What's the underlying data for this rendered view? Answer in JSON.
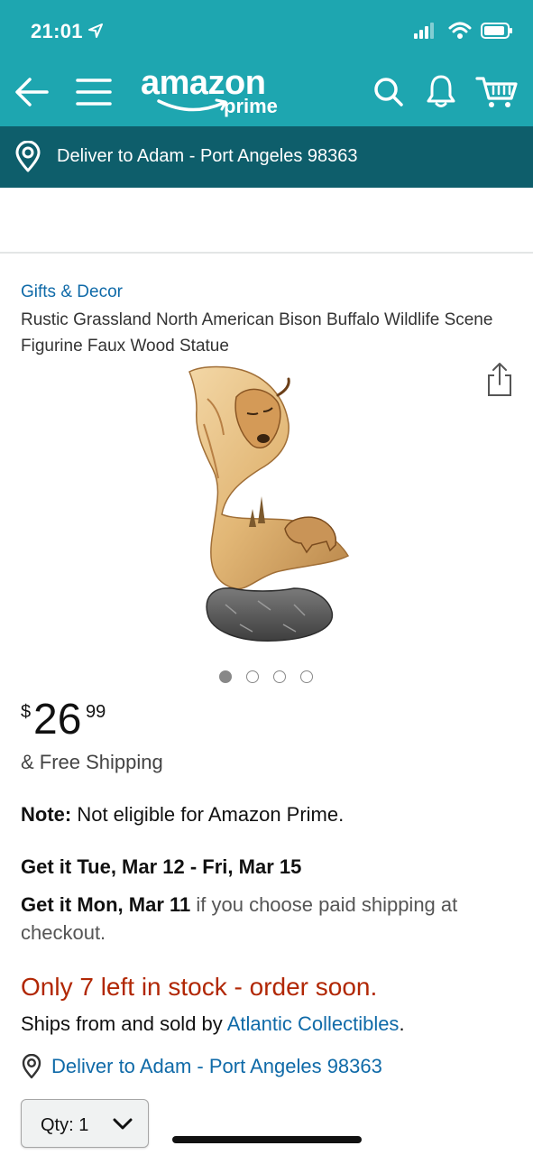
{
  "status_bar": {
    "time": "21:01",
    "icons": [
      "location-arrow-icon",
      "signal-icon",
      "wifi-icon",
      "battery-icon"
    ]
  },
  "header": {
    "logo_text": "amazon",
    "logo_subtext": "prime",
    "icons": [
      "back-arrow-icon",
      "menu-icon",
      "search-icon",
      "bell-icon",
      "cart-icon"
    ]
  },
  "delivery": {
    "text": "Deliver to Adam - Port Angeles 98363"
  },
  "product": {
    "byline": "Gifts & Decor",
    "title": "Rustic Grassland North American Bison Buffalo Wildlife Scene Figurine Faux Wood Statue",
    "image_count": 4,
    "active_image": 1,
    "price": {
      "currency": "$",
      "whole": "26",
      "fraction": "99"
    },
    "shipping": "& Free Shipping",
    "note_label": "Note:",
    "note_text": " Not eligible for Amazon Prime.",
    "delivery_primary": "Get it Tue, Mar 12 - Fri, Mar 15",
    "delivery_paid_bold": "Get it Mon, Mar 11",
    "delivery_paid_rest": " if you choose paid shipping at checkout.",
    "stock": "Only 7 left in stock - order soon.",
    "ships_prefix": "Ships from and sold by ",
    "seller": "Atlantic Collectibles",
    "ships_suffix": ".",
    "deliver_link": "Deliver to Adam - Port Angeles 98363",
    "qty_label": "Qty:",
    "qty_value": "1"
  },
  "colors": {
    "header": "#1ea6b0",
    "delivery_bar": "#0e5e6b",
    "link": "#0f6aa8",
    "stock": "#b12704"
  }
}
